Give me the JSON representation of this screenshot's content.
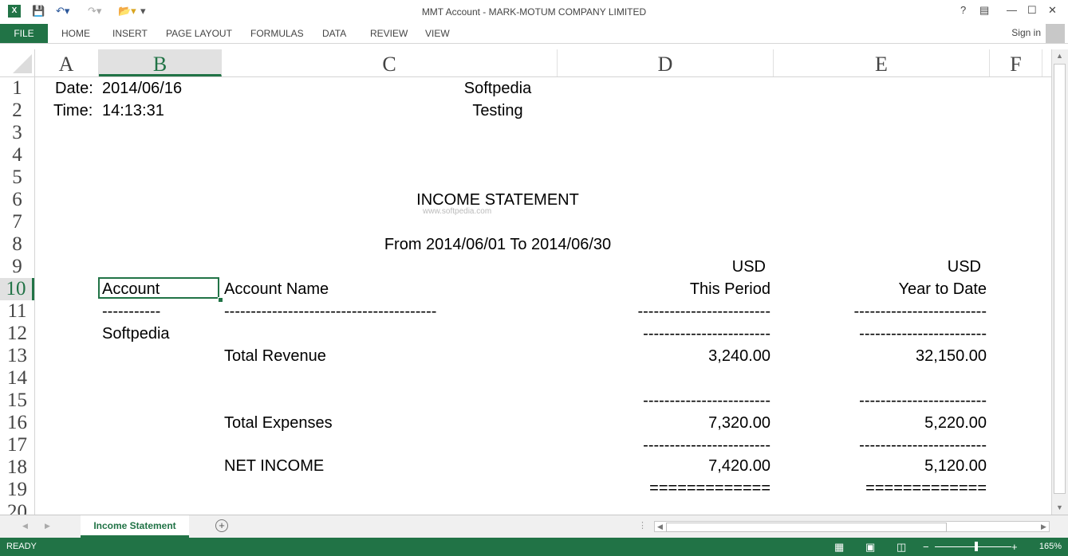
{
  "window": {
    "title": "MMT Account - MARK-MOTUM COMPANY LIMITED",
    "help": "?",
    "controls": [
      "—",
      "☐",
      "✕"
    ]
  },
  "ribbon": {
    "file": "FILE",
    "tabs": [
      "HOME",
      "INSERT",
      "PAGE LAYOUT",
      "FORMULAS",
      "DATA",
      "REVIEW",
      "VIEW"
    ],
    "signin": "Sign in"
  },
  "columns": [
    "A",
    "B",
    "C",
    "D",
    "E",
    "F"
  ],
  "rows": [
    "1",
    "2",
    "3",
    "4",
    "5",
    "6",
    "7",
    "8",
    "9",
    "10",
    "11",
    "12",
    "13",
    "14",
    "15",
    "16",
    "17",
    "18",
    "19",
    "20"
  ],
  "selected": {
    "column": "B",
    "row": "10"
  },
  "report": {
    "date_label": "Date:",
    "date": "2014/06/16",
    "time_label": "Time:",
    "time": "14:13:31",
    "company": "Softpedia",
    "subtitle": "Testing",
    "title": "INCOME STATEMENT",
    "period": "From  2014/06/01  To  2014/06/30",
    "currency1": "USD",
    "currency2": "USD",
    "col_account": "Account",
    "col_name": "Account Name",
    "col_period": "This Period",
    "col_ytd": "Year to Date",
    "dash_account": "-----------",
    "dash_name": "----------------------------------------",
    "dash_period": "-------------------------",
    "dash_ytd": "-------------------------",
    "group": "Softpedia",
    "sub_dash_period": "------------------------",
    "sub_dash_ytd": "------------------------",
    "revenue_label": "Total Revenue",
    "revenue_period": "3,240.00",
    "revenue_ytd": "32,150.00",
    "exp_dash_period": "------------------------",
    "exp_dash_ytd": "------------------------",
    "expenses_label": "Total Expenses",
    "expenses_period": "7,320.00",
    "expenses_ytd": "5,220.00",
    "net_dash_period": "------------------------",
    "net_dash_ytd": "------------------------",
    "net_label": "NET INCOME",
    "net_period": "7,420.00",
    "net_ytd": "5,120.00",
    "eq_period": "=============",
    "eq_ytd": "=============",
    "watermark": "www.softpedia.com"
  },
  "sheet_tabs": [
    "Income Statement"
  ],
  "status": {
    "ready": "READY",
    "zoom": "165%"
  },
  "colors": {
    "accent": "#217346"
  }
}
